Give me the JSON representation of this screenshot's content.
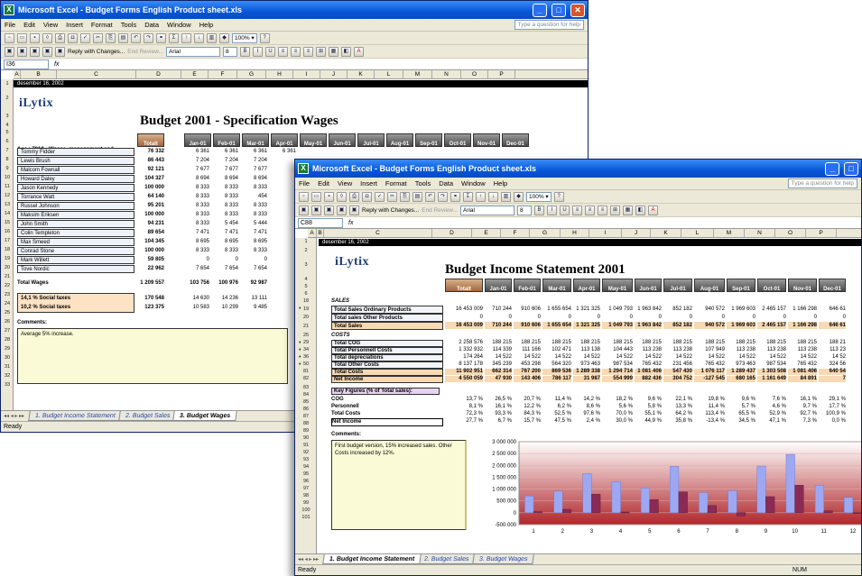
{
  "w1": {
    "title": "Microsoft Excel - Budget Forms English Product sheet.xls",
    "menu": [
      "File",
      "Edit",
      "View",
      "Insert",
      "Format",
      "Tools",
      "Data",
      "Window",
      "Help"
    ],
    "ask": "Type a question for help",
    "reply": "Reply with Changes...",
    "end_review": "End Review...",
    "font": "Arial",
    "namebox": "I36",
    "fx": "fx",
    "columns": [
      "A",
      "B",
      "C",
      "D",
      "E",
      "F",
      "G",
      "H",
      "I",
      "J",
      "K",
      "L",
      "M",
      "N",
      "O",
      "P"
    ],
    "date": "desember 16, 2002",
    "logo": "iLytix",
    "heading": "Budget 2001 - Specification Wages",
    "acc": "Acc : 7010 - Wages, management and",
    "months": [
      "Totalt",
      "Jan-01",
      "Feb-01",
      "Mar-01",
      "Apr-01",
      "May-01",
      "Jun-01",
      "Jul-01",
      "Aug-01",
      "Sep-01",
      "Oct-01",
      "Nov-01",
      "Dec-01"
    ],
    "rows": [
      {
        "r": "6",
        "name": "Tommy Fidder",
        "tot": "76 332",
        "v": [
          "6 361",
          "6 361",
          "6 361",
          "6 361"
        ]
      },
      {
        "r": "7",
        "name": "Lewis Brush",
        "tot": "86 443",
        "v": [
          "7 204",
          "7 204",
          "7 204"
        ]
      },
      {
        "r": "8",
        "name": "Malcom Fownall",
        "tot": "92 121",
        "v": [
          "7 677",
          "7 677",
          "7 677"
        ]
      },
      {
        "r": "9",
        "name": "Howard Daley",
        "tot": "104 327",
        "v": [
          "8 694",
          "8 694",
          "8 694"
        ]
      },
      {
        "r": "10",
        "name": "Jason Kennedy",
        "tot": "100 000",
        "v": [
          "8 333",
          "8 333",
          "8 333"
        ]
      },
      {
        "r": "11",
        "name": "Torrance Watt",
        "tot": "64 140",
        "v": [
          "8 333",
          "8 333",
          "454"
        ]
      },
      {
        "r": "12",
        "name": "Russel Johnson",
        "tot": "95 201",
        "v": [
          "8 333",
          "8 333",
          "8 333"
        ]
      },
      {
        "r": "13",
        "name": "Maksim Eriksen",
        "tot": "100 000",
        "v": [
          "8 333",
          "8 333",
          "8 333"
        ]
      },
      {
        "r": "14",
        "name": "John Smith",
        "tot": "94 231",
        "v": [
          "8 333",
          "5 454",
          "5 444"
        ]
      },
      {
        "r": "15",
        "name": "Colin Templeton",
        "tot": "89 654",
        "v": [
          "7 471",
          "7 471",
          "7 471"
        ]
      },
      {
        "r": "16",
        "name": "Max Smeed",
        "tot": "104 345",
        "v": [
          "8 695",
          "8 695",
          "8 695"
        ]
      },
      {
        "r": "17",
        "name": "Conrad Stone",
        "tot": "100 000",
        "v": [
          "8 333",
          "8 333",
          "8 333"
        ]
      },
      {
        "r": "18",
        "name": "Mark Willett",
        "tot": "59 805",
        "v": [
          "0",
          "0",
          "0"
        ]
      },
      {
        "r": "19",
        "name": "Tove Nordic",
        "tot": "22 962",
        "v": [
          "7 654",
          "7 654",
          "7 654"
        ]
      }
    ],
    "total_wages": {
      "label": "Total Wages",
      "tot": "1 209 557",
      "v": [
        "103 756",
        "100 976",
        "92 987"
      ]
    },
    "tax1": {
      "label": "14,1 %   Social taxes",
      "tot": "170 548",
      "v": [
        "14 630",
        "14 236",
        "13 111"
      ]
    },
    "tax2": {
      "label": "10,2 %   Social taxes",
      "tot": "123 375",
      "v": [
        "10 583",
        "10 299",
        "9 485"
      ]
    },
    "comments_label": "Comments:",
    "comment": "Average 5% increase.",
    "tabs": [
      "1. Budget Income Statement",
      "2. Budget Sales",
      "3. Budget Wages"
    ],
    "status": "Ready"
  },
  "w2": {
    "title": "Microsoft Excel - Budget Forms English Product sheet.xls",
    "menu": [
      "File",
      "Edit",
      "View",
      "Insert",
      "Format",
      "Tools",
      "Data",
      "Window",
      "Help"
    ],
    "ask": "Type a question for help",
    "reply": "Reply with Changes...",
    "end_review": "End Review...",
    "font": "Arial",
    "namebox": "C88",
    "fx": "fx",
    "columns": [
      "A",
      "B",
      "C",
      "D",
      "E",
      "F",
      "G",
      "H",
      "I",
      "J",
      "K",
      "L",
      "M",
      "N",
      "O",
      "P"
    ],
    "date": "desember 16, 2002",
    "logo": "iLytix",
    "heading": "Budget Income Statement 2001",
    "months": [
      "Totalt",
      "Jan-01",
      "Feb-01",
      "Mar-01",
      "Apr-01",
      "May-01",
      "Jun-01",
      "Jul-01",
      "Aug-01",
      "Sep-01",
      "Oct-01",
      "Nov-01",
      "Dec-01"
    ],
    "row_nums": [
      "1",
      "2",
      "3",
      "4",
      "5",
      "6",
      "18",
      "19",
      "20",
      "21",
      "25",
      "29",
      "34",
      "36",
      "50",
      "81",
      "82",
      "83",
      "84",
      "85",
      "86",
      "87",
      "88",
      "89",
      "90",
      "91",
      "92",
      "93",
      "94",
      "95",
      "96",
      "97",
      "98",
      "99",
      "100",
      "101"
    ],
    "sales_hdr": "SALES",
    "sales": [
      {
        "label": "Total Sales Ordinary Products",
        "v": [
          "16 453 009",
          "710 244",
          "910 606",
          "1 655 654",
          "1 321 325",
          "1 049 793",
          "1 963 842",
          "852 182",
          "940 572",
          "1 969 603",
          "2 465 157",
          "1 166 298",
          "646 61"
        ]
      },
      {
        "label": "Total sales Other Products",
        "v": [
          "0",
          "0",
          "0",
          "0",
          "0",
          "0",
          "0",
          "0",
          "0",
          "0",
          "0",
          "0",
          "0"
        ]
      },
      {
        "label": "Total Sales",
        "v": [
          "16 453 009",
          "710 244",
          "910 606",
          "1 655 654",
          "1 321 325",
          "1 049 793",
          "1 963 842",
          "852 182",
          "940 572",
          "1 969 603",
          "2 465 157",
          "1 166 298",
          "646 61"
        ]
      }
    ],
    "costs_hdr": "COSTS",
    "costs": [
      {
        "label": "Total COG",
        "v": [
          "2 258 576",
          "188 215",
          "188 215",
          "188 215",
          "188 215",
          "188 215",
          "188 215",
          "188 215",
          "188 215",
          "188 215",
          "188 215",
          "188 215",
          "188 21"
        ]
      },
      {
        "label": "Total Personnell Costs",
        "v": [
          "1 332 932",
          "114 339",
          "111 166",
          "102 471",
          "113 138",
          "104 443",
          "113 238",
          "113 238",
          "107 949",
          "113 238",
          "113 238",
          "113 238",
          "113 23"
        ]
      },
      {
        "label": "Total depreciations",
        "v": [
          "174 264",
          "14 522",
          "14 522",
          "14 522",
          "14 522",
          "14 522",
          "14 522",
          "14 522",
          "14 522",
          "14 522",
          "14 522",
          "14 522",
          "14 52"
        ]
      },
      {
        "label": "Total Other Costs",
        "v": [
          "8 137 178",
          "345 239",
          "453 298",
          "564 320",
          "973 463",
          "987 534",
          "765 432",
          "231 456",
          "765 432",
          "973 463",
          "987 534",
          "765 432",
          "324 56"
        ]
      },
      {
        "label": "Total Costs",
        "v": [
          "11 902 951",
          "662 314",
          "767 200",
          "869 536",
          "1 289 338",
          "1 294 714",
          "1 081 406",
          "547 430",
          "1 076 117",
          "1 289 437",
          "1 303 508",
          "1 081 406",
          "640 54"
        ]
      },
      {
        "label": "Net Income",
        "v": [
          "4 550 059",
          "47 930",
          "143 406",
          "786 117",
          "31 987",
          "554 999",
          "882 436",
          "304 752",
          "-127 545",
          "680 165",
          "1 161 649",
          "84 891",
          "7"
        ]
      }
    ],
    "kf_hdr": "Key Figures (% of Total sales):",
    "kf": [
      {
        "label": "COG",
        "v": [
          "13,7 %",
          "26,5 %",
          "20,7 %",
          "11,4 %",
          "14,2 %",
          "18,2 %",
          "9,6 %",
          "22,1 %",
          "19,8 %",
          "9,6 %",
          "7,6 %",
          "16,1 %",
          "29,1 %"
        ]
      },
      {
        "label": "Personnell",
        "v": [
          "8,1 %",
          "16,1 %",
          "12,2 %",
          "6,2 %",
          "8,6 %",
          "5,6 %",
          "5,8 %",
          "13,3 %",
          "11,4 %",
          "5,7 %",
          "4,6 %",
          "9,7 %",
          "17,7 %"
        ]
      },
      {
        "label": "Total Costs",
        "v": [
          "72,3 %",
          "93,3 %",
          "84,3 %",
          "52,5 %",
          "97,6 %",
          "70,0 %",
          "55,1 %",
          "64,2 %",
          "113,4 %",
          "65,5 %",
          "52,9 %",
          "92,7 %",
          "100,9 %"
        ]
      },
      {
        "label": "Net Income",
        "v": [
          "27,7 %",
          "6,7 %",
          "15,7 %",
          "47,5 %",
          "2,4 %",
          "30,0 %",
          "44,9 %",
          "35,8 %",
          "-13,4 %",
          "34,5 %",
          "47,1 %",
          "7,3 %",
          "0,0 %"
        ]
      }
    ],
    "comments_label": "Comments:",
    "comment": "First budget version, 15% increased sales.  Other Costs increased by 12%.",
    "tabs": [
      "1. Budget Income Statement",
      "2. Budget Sales",
      "3. Budget Wages"
    ],
    "status": "Ready",
    "num": "NUM"
  },
  "chart_data": {
    "type": "bar",
    "categories": [
      "1",
      "2",
      "3",
      "4",
      "5",
      "6",
      "7",
      "8",
      "9",
      "10",
      "11",
      "12"
    ],
    "series": [
      {
        "values": [
          710244,
          910606,
          1655654,
          1321325,
          1049793,
          1963842,
          852182,
          940572,
          1969603,
          2465157,
          1166298,
          646610
        ]
      },
      {
        "values": [
          47930,
          143406,
          786117,
          31987,
          554999,
          882436,
          304752,
          -127545,
          680165,
          1161649,
          84891,
          7000
        ]
      }
    ],
    "colors": [
      "#9ea8f2",
      "#8a2a55"
    ],
    "yticks": [
      "3 000 000",
      "2 500 000",
      "2 000 000",
      "1 500 000",
      "1 000 000",
      "500 000",
      "0",
      "-500 000"
    ],
    "ylim": [
      -500000,
      3000000
    ],
    "background": "#b0262a"
  }
}
